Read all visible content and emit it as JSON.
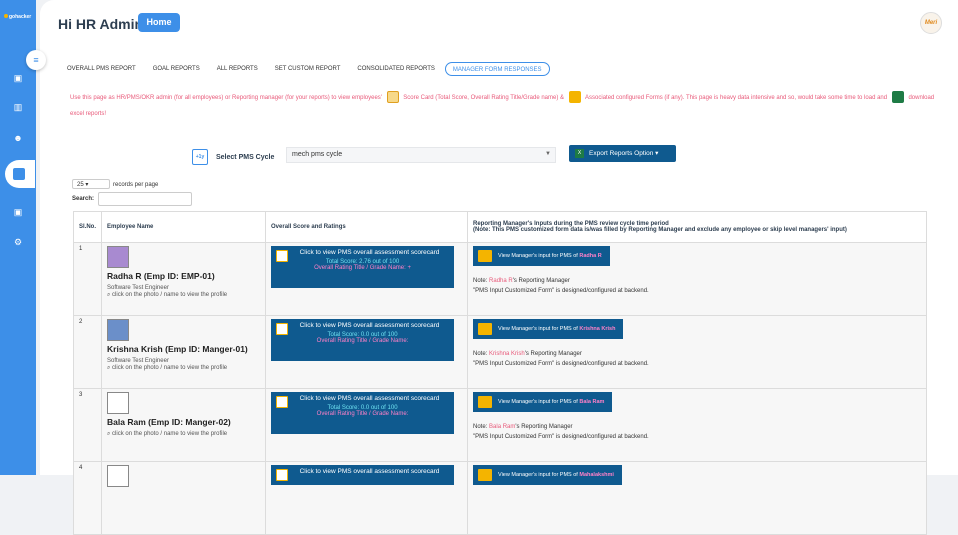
{
  "app": {
    "logo_text": "gohacker",
    "title": "Hi HR Admin",
    "home_label": "Home",
    "avatar_text": "Meri"
  },
  "tabs": [
    {
      "label": "OVERALL PMS REPORT",
      "active": false
    },
    {
      "label": "GOAL REPORTS",
      "active": false
    },
    {
      "label": "ALL REPORTS",
      "active": false
    },
    {
      "label": "SET CUSTOM REPORT",
      "active": false
    },
    {
      "label": "CONSOLIDATED REPORTS",
      "active": false
    },
    {
      "label": "MANAGER FORM RESPONSES",
      "active": true
    }
  ],
  "info": {
    "part1": "Use this page as HR/PMS/OKR admin (for all employees) or Reporting manager (for your reports) to view employees'",
    "part2": "Score Card (Total Score, Overall Rating Title/Grade name) &",
    "part3": "Associated configured Forms (if any). This page is heavy data intensive and so, would take some time to load and",
    "part4": "download excel reports!"
  },
  "controls": {
    "pms_label": "Select PMS Cycle",
    "pms_icon_text": "+1y",
    "pms_value": "mech pms cycle",
    "export_label": "Export Reports Option",
    "records_value": "25",
    "records_label": "records per page",
    "search_label": "Search:"
  },
  "table": {
    "headers": [
      "Sl.No.",
      "Employee Name",
      "Overall Score and Ratings",
      "Reporting Manager's Inputs during the PMS review cycle time period",
      "(Note: This PMS customized form data is/was filled by Reporting Manager and exclude any employee or skip level managers' input)"
    ],
    "rows": [
      {
        "sl": "1",
        "name": "Radha R (Emp ID: EMP-01)",
        "role": "Software Test Engineer",
        "hint": "click on the photo / name to view the profile",
        "score_btn": "Click to view PMS overall assessment scorecard",
        "total": "Total Score: 2.76 out of 100",
        "rating": "Overall Rating Title / Grade Name: +",
        "mgr_btn": "View Manager's input for PMS of",
        "mgr_name": "Radha R",
        "note_prefix": "Note:",
        "note_suffix": "'s Reporting Manager",
        "note2": "\"PMS Input Customized Form\" is designed/configured at backend."
      },
      {
        "sl": "2",
        "name": "Krishna Krish (Emp ID: Manger-01)",
        "role": "Software Test Engineer",
        "hint": "click on the photo / name to view the profile",
        "score_btn": "Click to view PMS overall assessment scorecard",
        "total": "Total Score: 0.0 out of 100",
        "rating": "Overall Rating Title / Grade Name:",
        "mgr_btn": "View Manager's input for PMS of",
        "mgr_name": "Krishna Krish",
        "note_prefix": "Note:",
        "note_suffix": "'s Reporting Manager",
        "note2": "\"PMS Input Customized Form\" is designed/configured at backend."
      },
      {
        "sl": "3",
        "name": "Bala Ram (Emp ID: Manger-02)",
        "role": "",
        "hint": "click on the photo / name to view the profile",
        "score_btn": "Click to view PMS overall assessment scorecard",
        "total": "Total Score: 0.0 out of 100",
        "rating": "Overall Rating Title / Grade Name:",
        "mgr_btn": "View Manager's input for PMS of",
        "mgr_name": "Bala Ram",
        "note_prefix": "Note:",
        "note_suffix": "'s Reporting Manager",
        "note2": "\"PMS Input Customized Form\" is designed/configured at backend."
      },
      {
        "sl": "4",
        "name": "",
        "role": "",
        "hint": "",
        "score_btn": "Click to view PMS overall assessment scorecard",
        "total": "",
        "rating": "",
        "mgr_btn": "View Manager's input for PMS of",
        "mgr_name": "Mahalakshmi",
        "note_prefix": "",
        "note_suffix": "",
        "note2": ""
      }
    ]
  }
}
